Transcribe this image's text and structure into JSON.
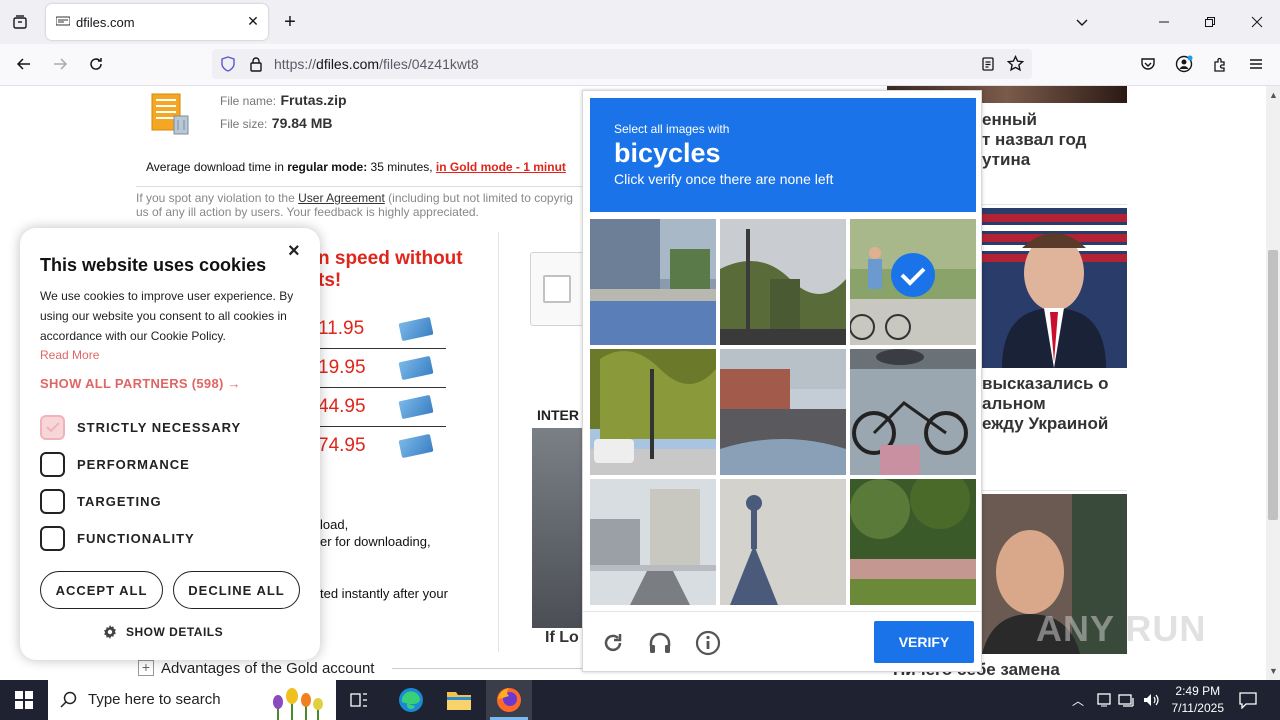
{
  "browser": {
    "tab_title": "dfiles.com",
    "url_prefix": "https://",
    "url_domain": "dfiles.com",
    "url_path": "/files/04z41kwt8"
  },
  "file": {
    "name_label": "File name:",
    "name": "Frutas.zip",
    "size_label": "File size:",
    "size": "79.84 MB"
  },
  "download": {
    "avg_prefix": "Average download time in ",
    "regular_mode": "regular mode:",
    "regular_time": " 35 minutes, ",
    "gold_mode": "in Gold mode - 1 minut"
  },
  "notice": {
    "pre": "If you spot any violation to the ",
    "link": "User Agreement",
    "post": " (including but not limited to copyrig",
    "line2": "us of any ill action by users. Your feedback is highly appreciated."
  },
  "promo": {
    "headline_1": "n speed without",
    "headline_2": "ts!",
    "prices": [
      "11.95",
      "19.95",
      "44.95",
      "74.95"
    ],
    "text_1": ",",
    "text_2": "load,",
    "text_3": "er for downloading,",
    "text_4": "ted instantly after your",
    "internet_label": "INTER",
    "if_lo": "If Lo",
    "advantages": "Advantages of the Gold account"
  },
  "news": {
    "item1_line1": "енный",
    "item1_line2": "т назвал год",
    "item1_line3": "утина",
    "item2_line1": "высказались о",
    "item2_line2": "альном",
    "item2_line3": "ежду Украиной",
    "item3": "Ничего себе замена"
  },
  "cookie": {
    "title": "This website uses cookies",
    "text": "We use cookies to improve user experience. By using our website you consent to all cookies in accordance with our Cookie Policy.",
    "read_more": "Read More",
    "partners": "SHOW ALL PARTNERS (598) →",
    "options": [
      "STRICTLY NECESSARY",
      "PERFORMANCE",
      "TARGETING",
      "FUNCTIONALITY"
    ],
    "accept": "ACCEPT ALL",
    "decline": "DECLINE ALL",
    "details": "SHOW DETAILS"
  },
  "captcha": {
    "instruction": "Select all images with",
    "target": "bicycles",
    "hint": "Click verify once there are none left",
    "verify": "VERIFY"
  },
  "taskbar": {
    "search_placeholder": "Type here to search",
    "time": "2:49 PM",
    "date": "7/11/2025"
  },
  "watermark": "ANY RUN",
  "colors": {
    "accent_blue": "#1a73e8",
    "gold_red": "#e0251b",
    "cookie_pink": "#e06666"
  }
}
